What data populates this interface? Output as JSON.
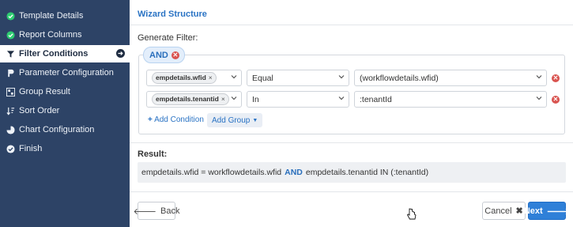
{
  "sidebar": {
    "items": [
      {
        "label": "Template Details",
        "icon": "check-circle-icon"
      },
      {
        "label": "Report Columns",
        "icon": "check-circle-icon"
      },
      {
        "label": "Filter Conditions",
        "icon": "filter-icon",
        "active": true
      },
      {
        "label": "Parameter Configuration",
        "icon": "parameter-icon"
      },
      {
        "label": "Group Result",
        "icon": "group-icon"
      },
      {
        "label": "Sort Order",
        "icon": "sort-icon"
      },
      {
        "label": "Chart Configuration",
        "icon": "pie-chart-icon"
      },
      {
        "label": "Finish",
        "icon": "check-circle-icon"
      }
    ]
  },
  "main": {
    "title": "Wizard Structure",
    "generate_filter_label": "Generate Filter:",
    "group_operator": "AND",
    "conditions": [
      {
        "field": "empdetails.wfid",
        "operator": "Equal",
        "value": "(workflowdetails.wfid)"
      },
      {
        "field": "empdetails.tenantid",
        "operator": "In",
        "value": ":tenantId"
      }
    ],
    "add_condition_label": "Add Condition",
    "add_group_label": "Add Group",
    "result_label": "Result:",
    "result": {
      "part1": "empdetails.wfid = workflowdetails.wfid",
      "op": "AND",
      "part2": "empdetails.tenantid IN (:tenantId)"
    },
    "back_label": "Back",
    "cancel_label": "Cancel",
    "next_label": "Next"
  },
  "colors": {
    "sidebar_bg": "#2d4366",
    "accent": "#2a73c4",
    "danger": "#d9534f",
    "primary_button": "#2f80d8"
  }
}
